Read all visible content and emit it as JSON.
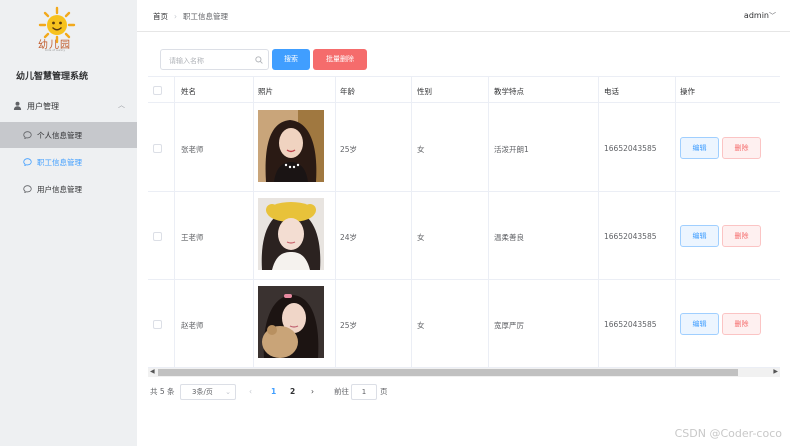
{
  "sidebar": {
    "logo_text": "幼儿园",
    "logo_sub": "Kids of sunny",
    "system_title": "幼儿智慧管理系统",
    "group_label": "用户管理",
    "items": [
      {
        "label": "个人信息管理"
      },
      {
        "label": "职工信息管理"
      },
      {
        "label": "用户信息管理"
      }
    ]
  },
  "header": {
    "breadcrumb_home": "首页",
    "breadcrumb_current": "职工信息管理",
    "user": "admin"
  },
  "toolbar": {
    "search_placeholder": "请输入名称",
    "search_button": "搜索",
    "batch_delete_button": "批量删除"
  },
  "table": {
    "columns": [
      "姓名",
      "照片",
      "年龄",
      "性别",
      "教学特点",
      "电话",
      "操作"
    ],
    "rows": [
      {
        "name": "张老师",
        "age": "25岁",
        "gender": "女",
        "feature": "活泼开朗1",
        "phone": "16652043585"
      },
      {
        "name": "王老师",
        "age": "24岁",
        "gender": "女",
        "feature": "温柔善良",
        "phone": "16652043585"
      },
      {
        "name": "赵老师",
        "age": "25岁",
        "gender": "女",
        "feature": "宽厚严厉",
        "phone": "16652043585"
      }
    ],
    "edit_label": "编辑",
    "delete_label": "删除"
  },
  "pagination": {
    "total_text": "共 5 条",
    "page_size": "3条/页",
    "pages": [
      "1",
      "2"
    ],
    "current_page": "1",
    "goto_label": "前往",
    "goto_value": "1",
    "page_suffix": "页",
    "prev": "‹",
    "next": "›"
  },
  "watermark": "CSDN @Coder-coco",
  "colors": {
    "primary": "#409eff",
    "danger": "#f56c6c",
    "sidebar_bg": "#eef0f2"
  }
}
